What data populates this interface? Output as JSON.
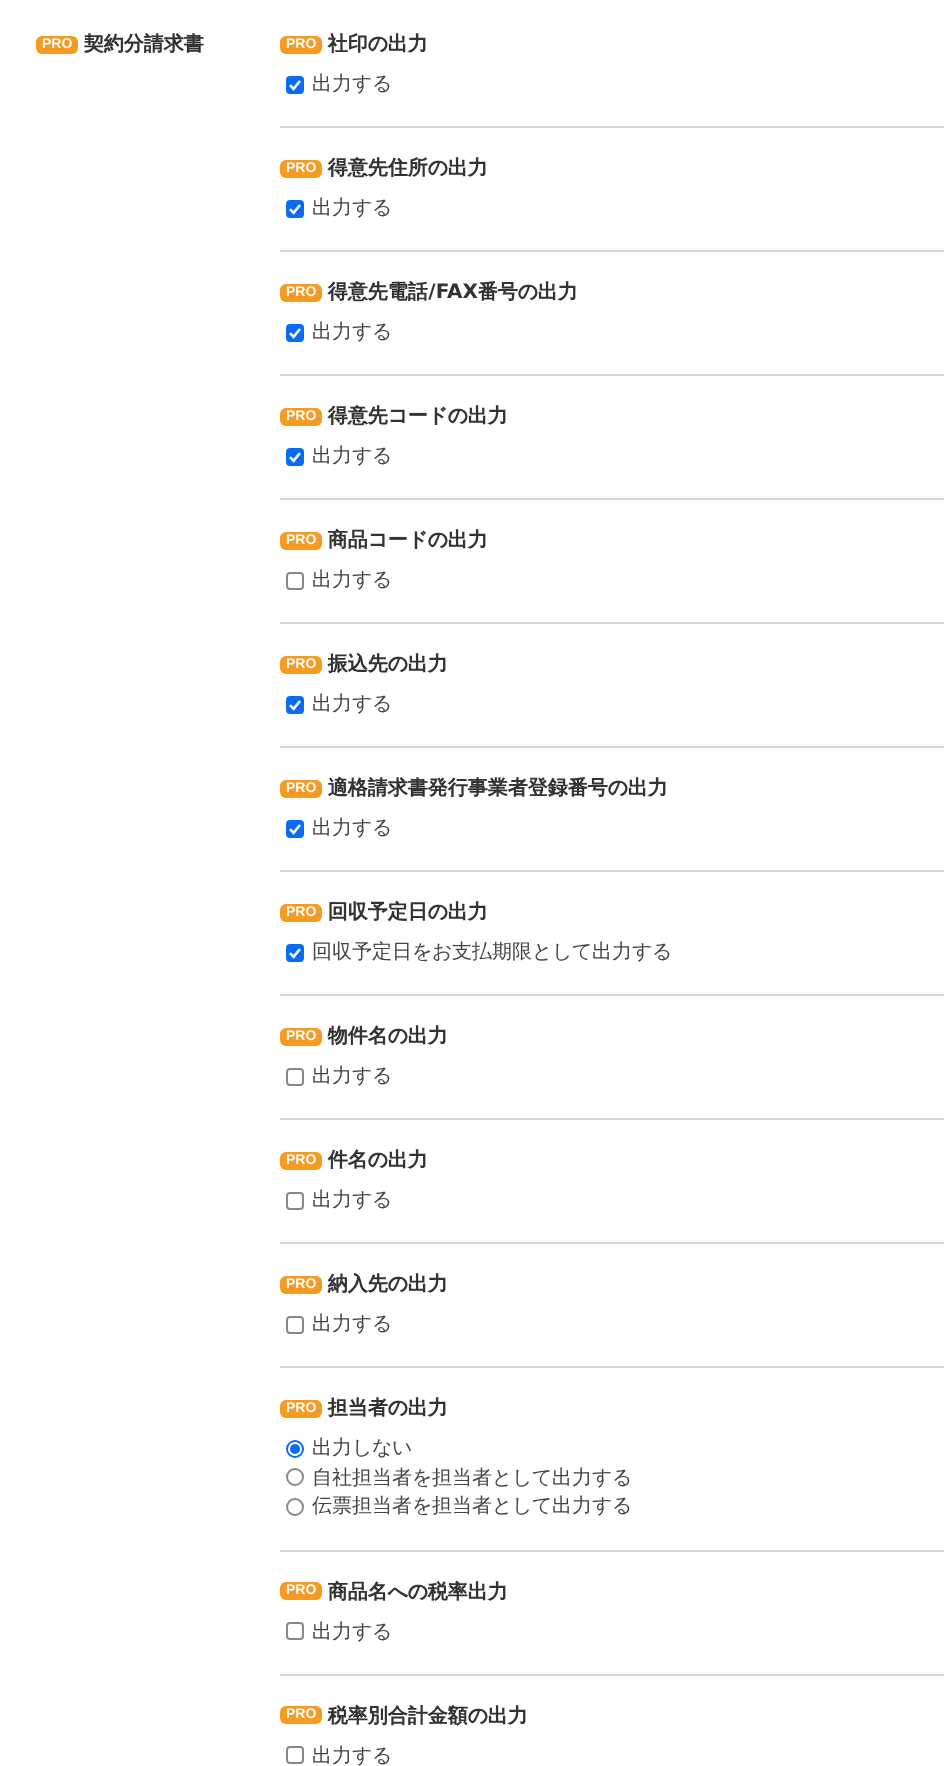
{
  "category": {
    "badge": "PRO",
    "label": "契約分請求書"
  },
  "settings": [
    {
      "badge": "PRO",
      "title": "社印の出力",
      "kind": "checkbox",
      "options": [
        {
          "label": "出力する",
          "checked": true
        }
      ]
    },
    {
      "badge": "PRO",
      "title": "得意先住所の出力",
      "kind": "checkbox",
      "options": [
        {
          "label": "出力する",
          "checked": true
        }
      ]
    },
    {
      "badge": "PRO",
      "title": "得意先電話/FAX番号の出力",
      "kind": "checkbox",
      "options": [
        {
          "label": "出力する",
          "checked": true
        }
      ]
    },
    {
      "badge": "PRO",
      "title": "得意先コードの出力",
      "kind": "checkbox",
      "options": [
        {
          "label": "出力する",
          "checked": true
        }
      ]
    },
    {
      "badge": "PRO",
      "title": "商品コードの出力",
      "kind": "checkbox",
      "options": [
        {
          "label": "出力する",
          "checked": false
        }
      ]
    },
    {
      "badge": "PRO",
      "title": "振込先の出力",
      "kind": "checkbox",
      "options": [
        {
          "label": "出力する",
          "checked": true
        }
      ]
    },
    {
      "badge": "PRO",
      "title": "適格請求書発行事業者登録番号の出力",
      "kind": "checkbox",
      "options": [
        {
          "label": "出力する",
          "checked": true
        }
      ]
    },
    {
      "badge": "PRO",
      "title": "回収予定日の出力",
      "kind": "checkbox",
      "options": [
        {
          "label": "回収予定日をお支払期限として出力する",
          "checked": true
        }
      ]
    },
    {
      "badge": "PRO",
      "title": "物件名の出力",
      "kind": "checkbox",
      "options": [
        {
          "label": "出力する",
          "checked": false
        }
      ]
    },
    {
      "badge": "PRO",
      "title": "件名の出力",
      "kind": "checkbox",
      "options": [
        {
          "label": "出力する",
          "checked": false
        }
      ]
    },
    {
      "badge": "PRO",
      "title": "納入先の出力",
      "kind": "checkbox",
      "options": [
        {
          "label": "出力する",
          "checked": false
        }
      ]
    },
    {
      "badge": "PRO",
      "title": "担当者の出力",
      "kind": "radio",
      "options": [
        {
          "label": "出力しない",
          "selected": true
        },
        {
          "label": "自社担当者を担当者として出力する",
          "selected": false
        },
        {
          "label": "伝票担当者を担当者として出力する",
          "selected": false
        }
      ]
    },
    {
      "badge": "PRO",
      "title": "商品名への税率出力",
      "kind": "checkbox",
      "options": [
        {
          "label": "出力する",
          "checked": false
        }
      ]
    },
    {
      "badge": "PRO",
      "title": "税率別合計金額の出力",
      "kind": "checkbox",
      "options": [
        {
          "label": "出力する",
          "checked": false
        }
      ]
    }
  ]
}
